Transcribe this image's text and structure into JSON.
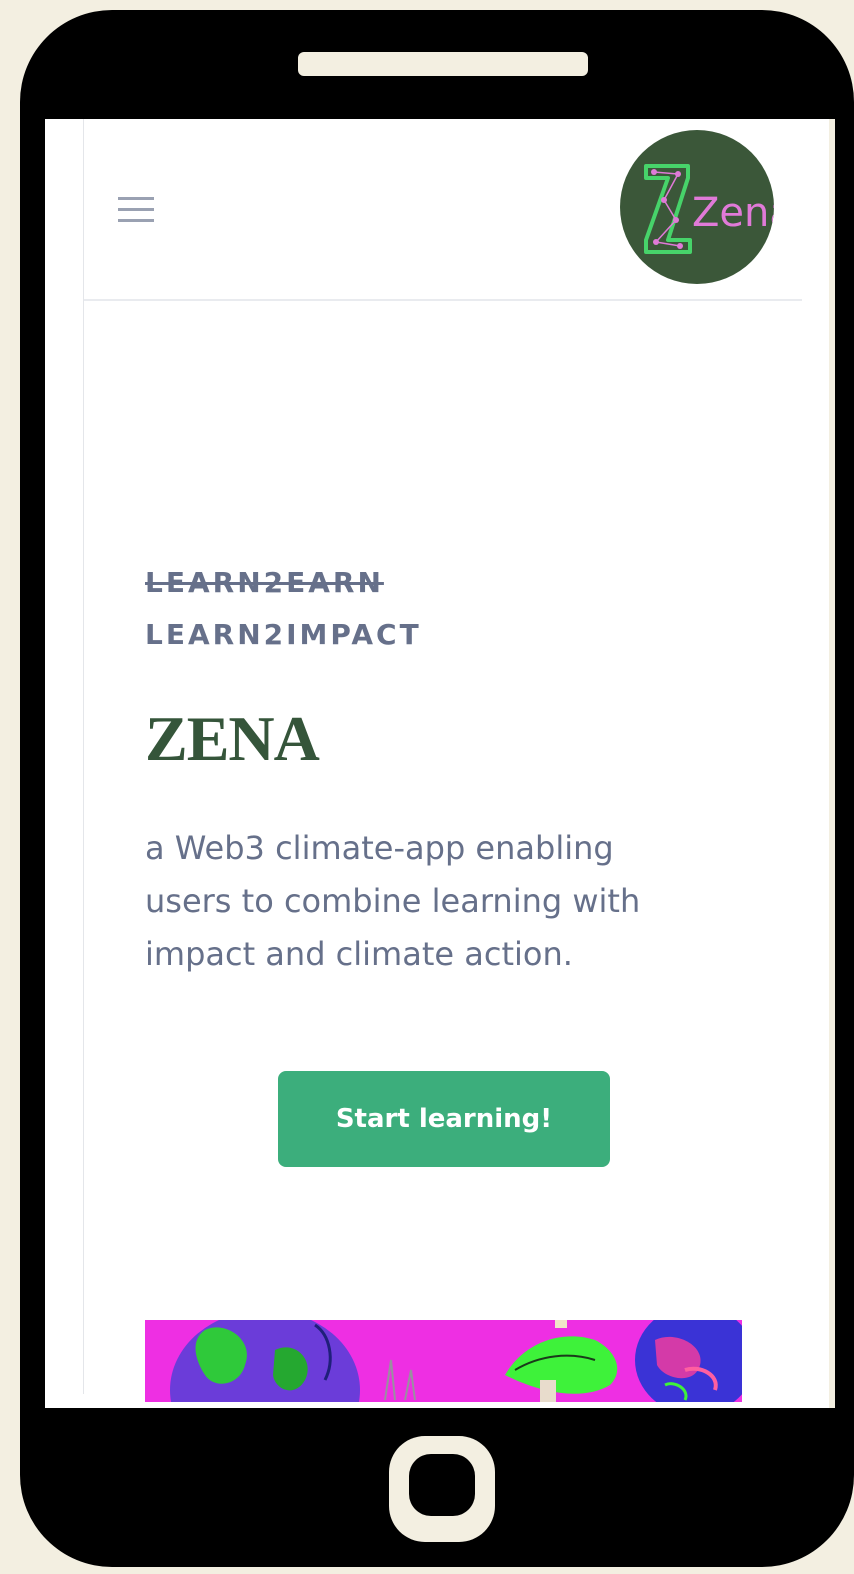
{
  "header": {
    "menu_icon": "hamburger-menu-icon",
    "logo": {
      "text": "Zena",
      "icon": "zena-logo",
      "background": "#3b5739",
      "accent_green": "#47d36a",
      "accent_pink": "#e07ad8"
    }
  },
  "hero": {
    "tag_struck": "LEARN2EARN",
    "tag": "LEARN2IMPACT",
    "title": "ZENA",
    "description": "a Web3 climate-app enabling users to combine learning with impact and climate action.",
    "cta_label": "Start learning!"
  },
  "colors": {
    "page_background": "#f3efe1",
    "phone_frame": "#000000",
    "title": "#35553a",
    "body_text": "#66708a",
    "cta": "#3cae7c",
    "image_magenta": "#ee2fe3"
  },
  "hero_image": {
    "icon": "earth-illustration"
  }
}
